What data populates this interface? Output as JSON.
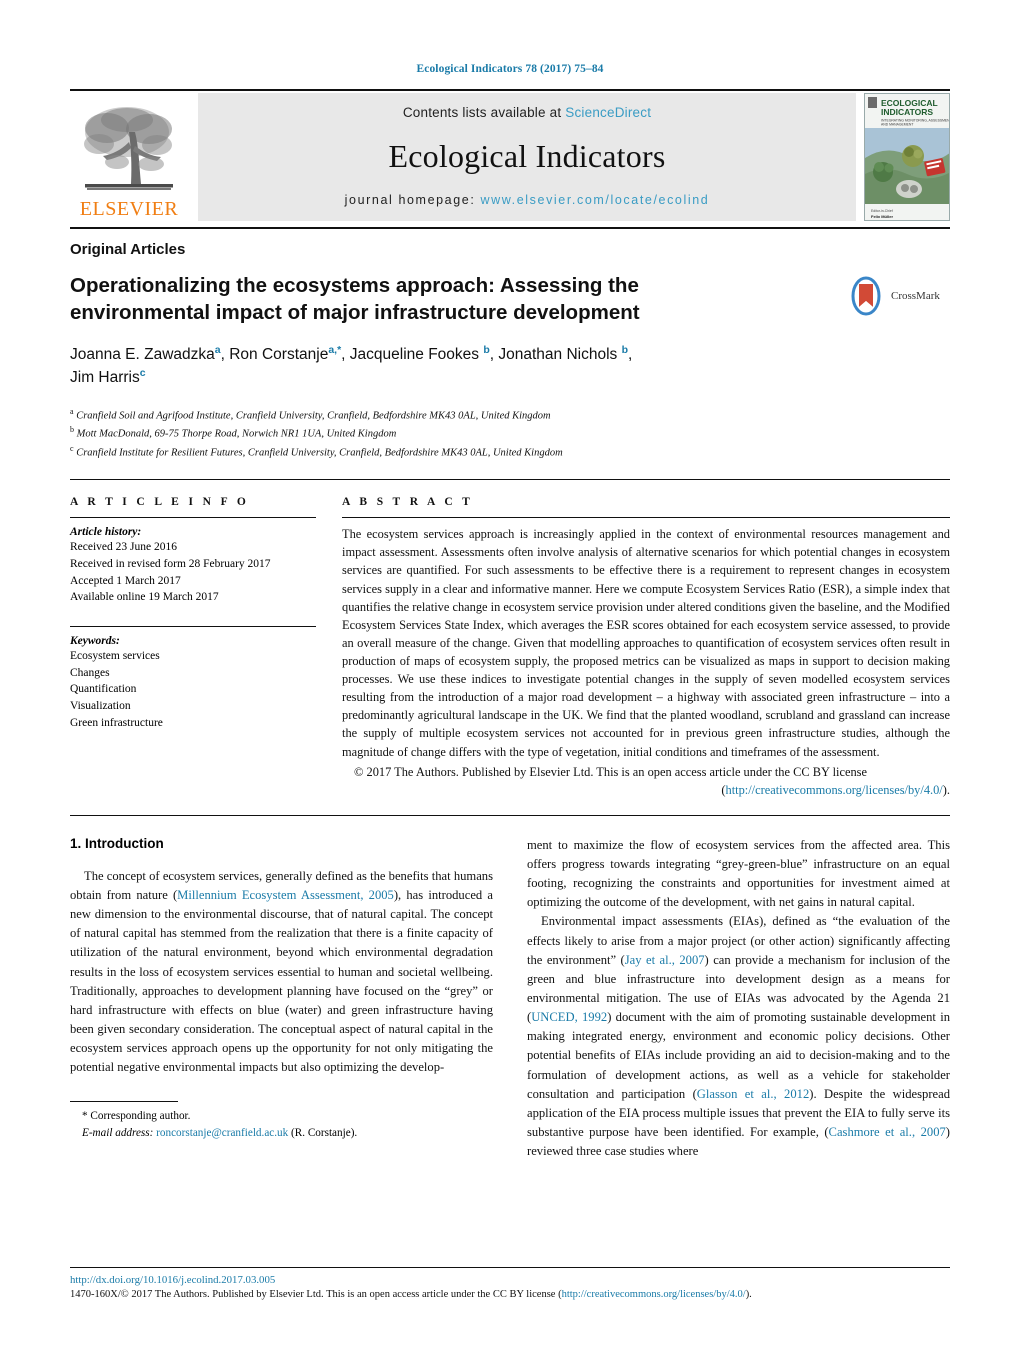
{
  "running_head": "Ecological Indicators 78 (2017) 75–84",
  "masthead": {
    "contents_prefix": "Contents lists available at ",
    "sciencedirect_label": "ScienceDirect",
    "journal_name": "Ecological Indicators",
    "homepage_prefix": "journal homepage: ",
    "homepage_url": "www.elsevier.com/locate/ecolind",
    "publisher_name": "ELSEVIER",
    "cover": {
      "line1": "ECOLOGICAL",
      "line2": "INDICATORS",
      "line3": "INTEGRATING MONITORING, ASSESSMENT AND MANAGEMENT",
      "footer1": "Editor-in-Chief",
      "footer2": "Felix Müller"
    },
    "accent_blue": "#3a9cc4",
    "elsevier_orange": "#F07E13"
  },
  "article": {
    "kicker": "Original Articles",
    "title": "Operationalizing the ecosystems approach: Assessing the environmental impact of major infrastructure development",
    "authors_line1": "Joanna E. Zawadzka",
    "authors": [
      {
        "name": "Joanna E. Zawadzka",
        "sup": "a"
      },
      {
        "name": "Ron Corstanje",
        "sup": "a,*"
      },
      {
        "name": "Jacqueline Fookes",
        "sup": "b"
      },
      {
        "name": "Jonathan Nichols",
        "sup": "b"
      },
      {
        "name": "Jim Harris",
        "sup": "c"
      }
    ],
    "affiliations": [
      {
        "sup": "a",
        "text": "Cranfield Soil and Agrifood Institute, Cranfield University, Cranfield, Bedfordshire MK43 0AL, United Kingdom"
      },
      {
        "sup": "b",
        "text": "Mott MacDonald, 69-75 Thorpe Road, Norwich NR1 1UA, United Kingdom"
      },
      {
        "sup": "c",
        "text": "Cranfield Institute for Resilient Futures, Cranfield University, Cranfield, Bedfordshire MK43 0AL, United Kingdom"
      }
    ],
    "crossmark_label": "CrossMark"
  },
  "article_info": {
    "heading": "A R T I C L E  I N F O",
    "history_title": "Article history:",
    "history": [
      "Received 23 June 2016",
      "Received in revised form 28 February 2017",
      "Accepted 1 March 2017",
      "Available online 19 March 2017"
    ],
    "keywords_title": "Keywords:",
    "keywords": [
      "Ecosystem services",
      "Changes",
      "Quantification",
      "Visualization",
      "Green infrastructure"
    ]
  },
  "abstract": {
    "heading": "A B S T R A C T",
    "text": "The ecosystem services approach is increasingly applied in the context of environmental resources management and impact assessment. Assessments often involve analysis of alternative scenarios for which potential changes in ecosystem services are quantified. For such assessments to be effective there is a requirement to represent changes in ecosystem services supply in a clear and informative manner. Here we compute Ecosystem Services Ratio (ESR), a simple index that quantifies the relative change in ecosystem service provision under altered conditions given the baseline, and the Modified Ecosystem Services State Index, which averages the ESR scores obtained for each ecosystem service assessed, to provide an overall measure of the change. Given that modelling approaches to quantification of ecosystem services often result in production of maps of ecosystem supply, the proposed metrics can be visualized as maps in support to decision making processes. We use these indices to investigate potential changes in the supply of seven modelled ecosystem services resulting from the introduction of a major road development – a highway with associated green infrastructure – into a predominantly agricultural landscape in the UK. We find that the planted woodland, scrubland and grassland can increase the supply of multiple ecosystem services not accounted for in previous green infrastructure studies, although the magnitude of change differs with the type of vegetation, initial conditions and timeframes of the assessment.",
    "copyright": "© 2017 The Authors. Published by Elsevier Ltd. This is an open access article under the CC BY license",
    "license_open": "(",
    "license_url": "http://creativecommons.org/licenses/by/4.0/",
    "license_close": ")."
  },
  "introduction": {
    "heading": "1.  Introduction",
    "left_para1_a": "The concept of ecosystem services, generally defined as the benefits that humans obtain from nature (",
    "left_cite1": "Millennium Ecosystem Assessment, 2005",
    "left_para1_b": "), has introduced a new dimension to the environmental discourse, that of natural capital. The concept of natural capital has stemmed from the realization that there is a finite capacity of utilization of the natural environment, beyond which environmental degradation results in the loss of ecosystem services essential to human and societal wellbeing. Traditionally, approaches to development planning have focused on the “grey” or hard infrastructure with effects on blue (water) and green infrastructure having been given secondary consideration. The conceptual aspect of natural capital in the ecosystem services approach opens up the opportunity for not only mitigating the potential negative environmental impacts but also optimizing the develop-",
    "right_para1": "ment to maximize the flow of ecosystem services from the affected area. This offers progress towards integrating “grey-green-blue” infrastructure on an equal footing, recognizing the constraints and opportunities for investment aimed at optimizing the outcome of the development, with net gains in natural capital.",
    "right_para2_a": "Environmental impact assessments (EIAs), defined as “the evaluation of the effects likely to arise from a major project (or other action) significantly affecting the environment” (",
    "right_cite1": "Jay et al., 2007",
    "right_para2_b": ") can provide a mechanism for inclusion of the green and blue infrastructure into development design as a means for environmental mitigation. The use of EIAs was advocated by the Agenda 21 (",
    "right_cite2": "UNCED, 1992",
    "right_para2_c": ") document with the aim of promoting sustainable development in making integrated energy, environment and economic policy decisions. Other potential benefits of EIAs include providing an aid to decision-making and to the formulation of development actions, as well as a vehicle for stakeholder consultation and participation (",
    "right_cite3": "Glasson et al., 2012",
    "right_para2_d": "). Despite the widespread application of the EIA process multiple issues that prevent the EIA to fully serve its substantive purpose have been identified. For example, (",
    "right_cite4": "Cashmore et al., 2007",
    "right_para2_e": ") reviewed three case studies where"
  },
  "footnote": {
    "corresponding": "* Corresponding author.",
    "email_label": "E-mail address:",
    "email": "roncorstanje@cranfield.ac.uk",
    "email_owner": "(R. Corstanje)."
  },
  "footer": {
    "doi": "http://dx.doi.org/10.1016/j.ecolind.2017.03.005",
    "issn_text": "1470-160X/© 2017 The Authors. Published by Elsevier Ltd. This is an open access article under the CC BY license (",
    "issn_link": "http://creativecommons.org/licenses/by/4.0/",
    "issn_close": ")."
  }
}
